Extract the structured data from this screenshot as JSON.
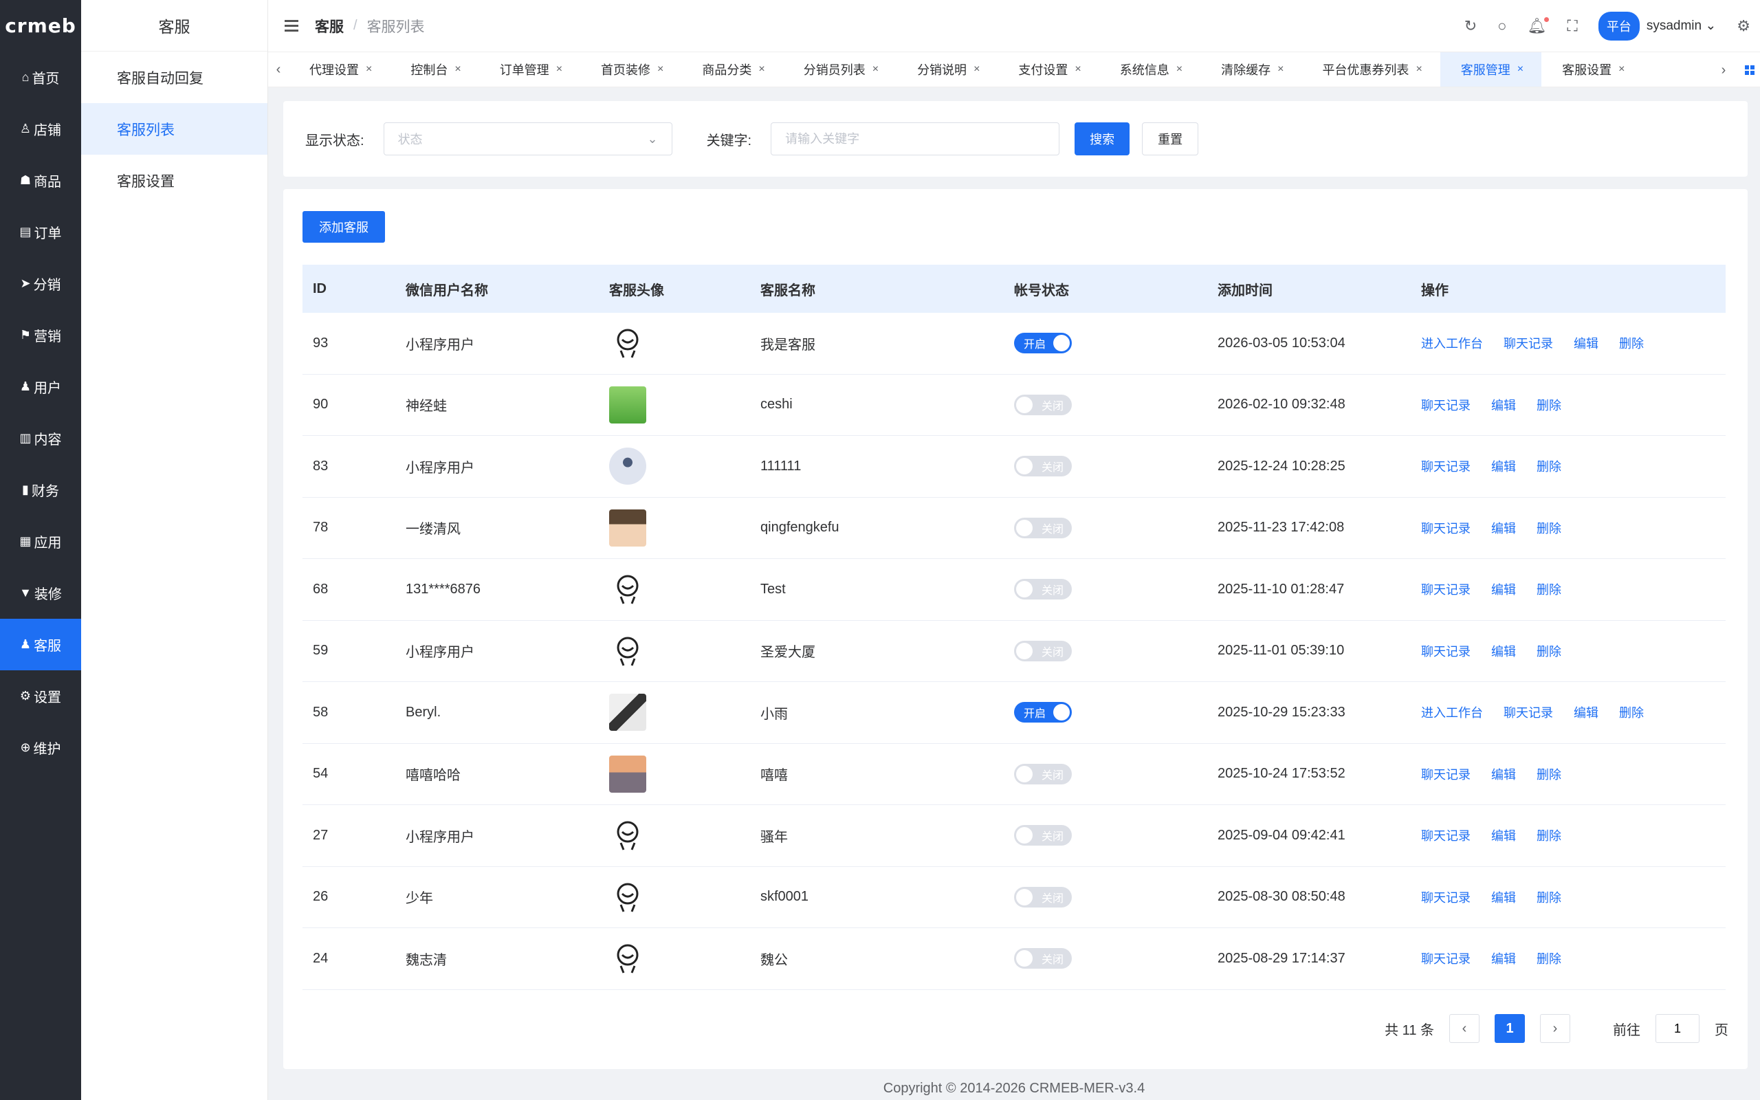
{
  "logo": "crmeb",
  "sidebar": {
    "items": [
      {
        "label": "首页",
        "icon": "home-icon",
        "glyph": "⌂"
      },
      {
        "label": "店铺",
        "icon": "store-icon",
        "glyph": "♙"
      },
      {
        "label": "商品",
        "icon": "goods-icon",
        "glyph": "☗"
      },
      {
        "label": "订单",
        "icon": "order-icon",
        "glyph": "▤"
      },
      {
        "label": "分销",
        "icon": "distribution-icon",
        "glyph": "➤"
      },
      {
        "label": "营销",
        "icon": "marketing-icon",
        "glyph": "⚑"
      },
      {
        "label": "用户",
        "icon": "user-icon",
        "glyph": "♟"
      },
      {
        "label": "内容",
        "icon": "content-icon",
        "glyph": "▥"
      },
      {
        "label": "财务",
        "icon": "finance-icon",
        "glyph": "▮"
      },
      {
        "label": "应用",
        "icon": "apps-icon",
        "glyph": "▦"
      },
      {
        "label": "装修",
        "icon": "decorate-icon",
        "glyph": "▼"
      },
      {
        "label": "客服",
        "icon": "service-icon",
        "glyph": "♟"
      },
      {
        "label": "设置",
        "icon": "gear-icon",
        "glyph": "⚙"
      },
      {
        "label": "维护",
        "icon": "maintain-icon",
        "glyph": "⊕"
      }
    ],
    "active_index": 11
  },
  "submenu": {
    "title": "客服",
    "items": [
      "客服自动回复",
      "客服列表",
      "客服设置"
    ],
    "active_index": 1
  },
  "header": {
    "crumb_main": "客服",
    "crumb_sub": "客服列表",
    "platform_badge": "平台",
    "username": "sysadmin"
  },
  "tabs": {
    "items": [
      "代理设置",
      "控制台",
      "订单管理",
      "首页装修",
      "商品分类",
      "分销员列表",
      "分销说明",
      "支付设置",
      "系统信息",
      "清除缓存",
      "平台优惠券列表",
      "客服管理",
      "客服设置"
    ],
    "active_index": 11
  },
  "filter": {
    "status_label": "显示状态:",
    "status_placeholder": "状态",
    "keyword_label": "关键字:",
    "keyword_placeholder": "请输入关键字",
    "search_label": "搜索",
    "reset_label": "重置"
  },
  "table": {
    "add_label": "添加客服",
    "columns": [
      "ID",
      "微信用户名称",
      "客服头像",
      "客服名称",
      "帐号状态",
      "添加时间",
      "操作"
    ],
    "status_on": "开启",
    "status_off": "关闭",
    "op_workbench": "进入工作台",
    "op_chat": "聊天记录",
    "op_edit": "编辑",
    "op_delete": "删除",
    "rows": [
      {
        "id": "93",
        "wx_name": "小程序用户",
        "avatar": "face",
        "name": "我是客服",
        "enabled": true,
        "time": "2026-03-05 10:53:04"
      },
      {
        "id": "90",
        "wx_name": "神经蛙",
        "avatar": "frog",
        "name": "ceshi",
        "enabled": false,
        "time": "2026-02-10 09:32:48"
      },
      {
        "id": "83",
        "wx_name": "小程序用户",
        "avatar": "round",
        "name": "111111",
        "enabled": false,
        "time": "2025-12-24 10:28:25"
      },
      {
        "id": "78",
        "wx_name": "一缕清风",
        "avatar": "boy",
        "name": "qingfengkefu",
        "enabled": false,
        "time": "2025-11-23 17:42:08"
      },
      {
        "id": "68",
        "wx_name": "131****6876",
        "avatar": "face",
        "name": "Test",
        "enabled": false,
        "time": "2025-11-10 01:28:47"
      },
      {
        "id": "59",
        "wx_name": "小程序用户",
        "avatar": "face",
        "name": "圣爱大厦",
        "enabled": false,
        "time": "2025-11-01 05:39:10"
      },
      {
        "id": "58",
        "wx_name": "Beryl.",
        "avatar": "girl",
        "name": "小雨",
        "enabled": true,
        "time": "2025-10-29 15:23:33"
      },
      {
        "id": "54",
        "wx_name": "嘻嘻哈哈",
        "avatar": "sunset",
        "name": "嘻嘻",
        "enabled": false,
        "time": "2025-10-24 17:53:52"
      },
      {
        "id": "27",
        "wx_name": "小程序用户",
        "avatar": "face",
        "name": "骚年",
        "enabled": false,
        "time": "2025-09-04 09:42:41"
      },
      {
        "id": "26",
        "wx_name": "少年",
        "avatar": "face",
        "name": "skf0001",
        "enabled": false,
        "time": "2025-08-30 08:50:48"
      },
      {
        "id": "24",
        "wx_name": "魏志清",
        "avatar": "face",
        "name": "魏公",
        "enabled": false,
        "time": "2025-08-29 17:14:37"
      }
    ]
  },
  "pagination": {
    "total_text": "共 11 条",
    "current_page": "1",
    "goto_label": "前往",
    "goto_value": "1",
    "page_suffix": "页"
  },
  "footer": "Copyright © 2014-2026 CRMEB-MER-v3.4"
}
